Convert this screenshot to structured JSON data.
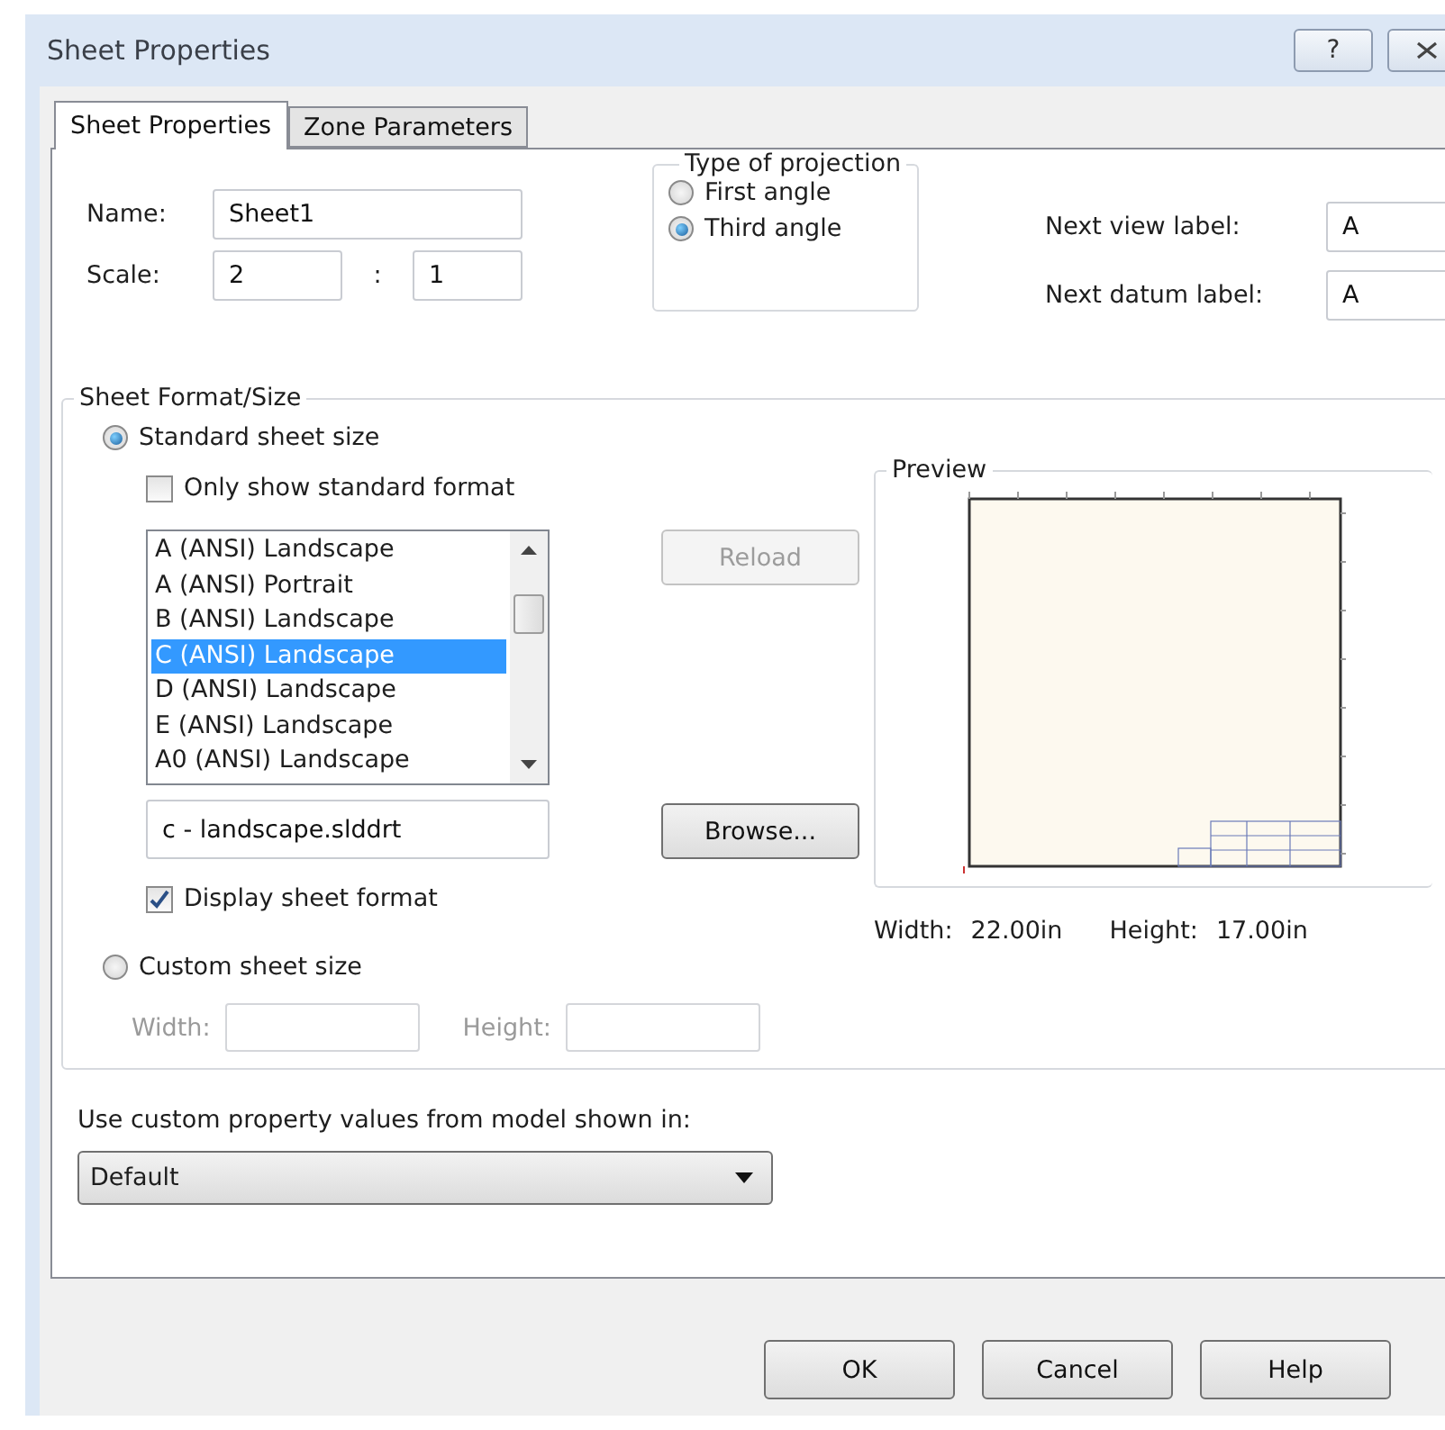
{
  "window": {
    "title": "Sheet Properties",
    "help_button": "?"
  },
  "tabs": [
    {
      "label": "Sheet Properties",
      "selected": true
    },
    {
      "label": "Zone Parameters",
      "selected": false
    }
  ],
  "name": {
    "label": "Name:",
    "value": "Sheet1"
  },
  "scale": {
    "label": "Scale:",
    "numerator": "2",
    "separator": ":",
    "denominator": "1"
  },
  "projection": {
    "title": "Type of projection",
    "options": [
      {
        "label": "First angle",
        "selected": false
      },
      {
        "label": "Third angle",
        "selected": true
      }
    ]
  },
  "next_labels": [
    {
      "label": "Next view label:",
      "value": "A"
    },
    {
      "label": "Next datum label:",
      "value": "A"
    }
  ],
  "sheet_format": {
    "title": "Sheet Format/Size",
    "standard": {
      "label": "Standard sheet size",
      "selected": true
    },
    "only_standard": {
      "label": "Only show standard format",
      "checked": false
    },
    "formats": [
      {
        "label": "A (ANSI) Landscape",
        "selected": false
      },
      {
        "label": "A (ANSI) Portrait",
        "selected": false
      },
      {
        "label": "B (ANSI) Landscape",
        "selected": false
      },
      {
        "label": "C (ANSI) Landscape",
        "selected": true
      },
      {
        "label": "D (ANSI) Landscape",
        "selected": false
      },
      {
        "label": "E (ANSI) Landscape",
        "selected": false
      },
      {
        "label": "A0 (ANSI) Landscape",
        "selected": false
      }
    ],
    "template_file": "c - landscape.slddrt",
    "display_format": {
      "label": "Display sheet format",
      "checked": true
    },
    "reload_button": {
      "label": "Reload",
      "disabled": true
    },
    "browse_button": {
      "label": "Browse...",
      "disabled": false
    },
    "preview": {
      "title": "Preview",
      "width_label": "Width:",
      "width": "22.00in",
      "height_label": "Height:",
      "height": "17.00in"
    },
    "custom": {
      "label": "Custom sheet size",
      "selected": false
    },
    "custom_fields": [
      {
        "label": "Width:",
        "disabled": true
      },
      {
        "label": "Height:",
        "disabled": true
      }
    ]
  },
  "model_property": {
    "label": "Use custom property values from model shown in:",
    "value": "Default"
  },
  "buttons": [
    "OK",
    "Cancel",
    "Help"
  ]
}
